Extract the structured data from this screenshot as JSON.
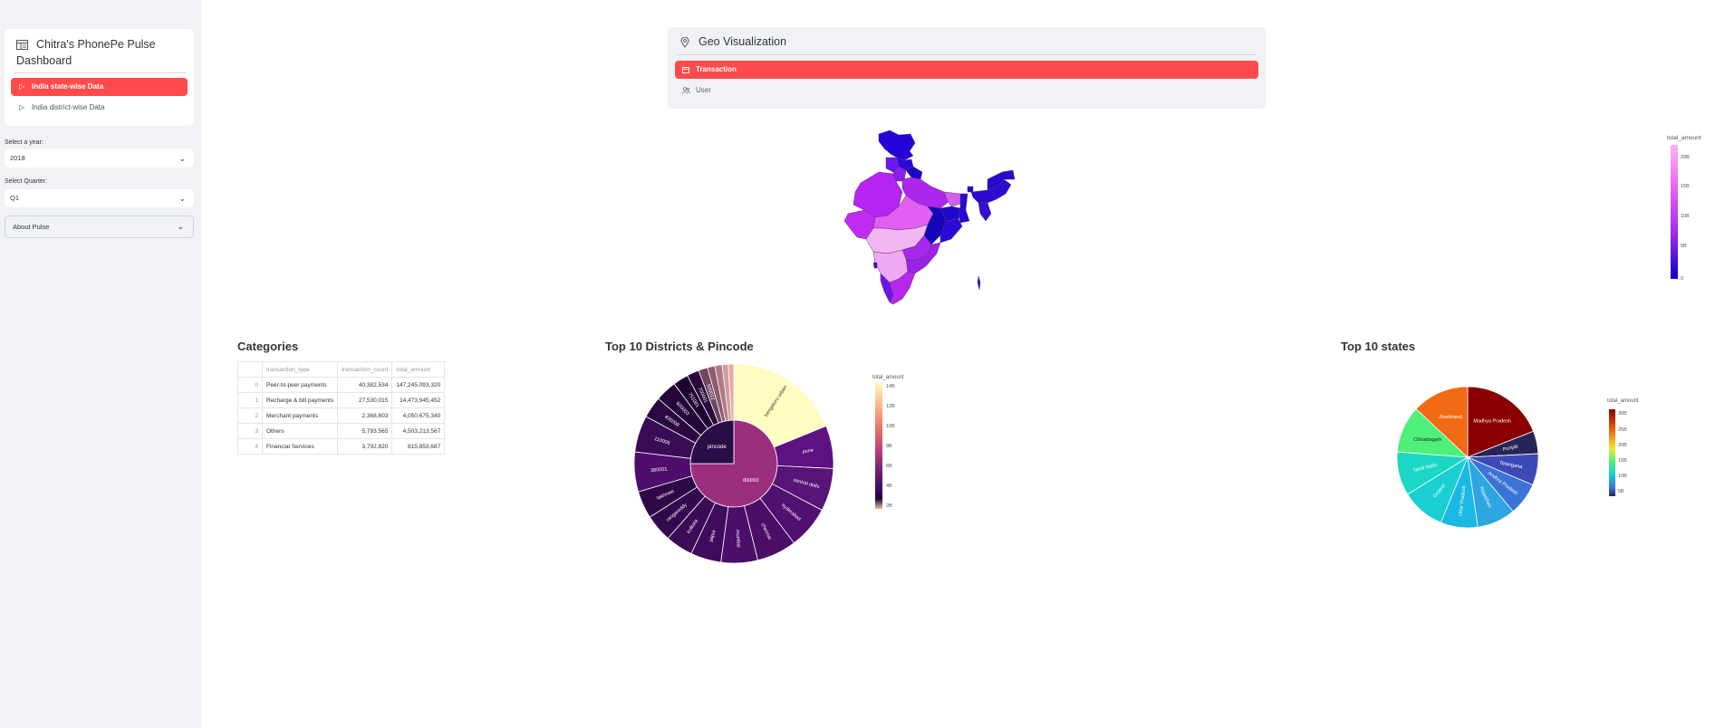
{
  "sidebar": {
    "menu_title_line1": "Chitra's PhonePe Pulse",
    "menu_title_line2": "Dashboard",
    "menu_items": [
      {
        "label": "India state-wise Data",
        "active": true
      },
      {
        "label": "India district-wise Data",
        "active": false
      }
    ],
    "year_label": "Select a year:",
    "year_value": "2018",
    "quarter_label": "Select Quarter:",
    "quarter_value": "Q1",
    "about_label": "About Pulse"
  },
  "geo": {
    "title": "Geo Visualization",
    "tabs": [
      {
        "label": "Transaction",
        "active": true
      },
      {
        "label": "User",
        "active": false
      }
    ],
    "colorbar_title": "total_amount",
    "colorbar_ticks": [
      "20B",
      "15B",
      "10B",
      "5B",
      "0"
    ]
  },
  "categories": {
    "title": "Categories",
    "columns": [
      "",
      "transaction_type",
      "transaction_count",
      "total_amount"
    ],
    "rows": [
      {
        "index": "0",
        "type": "Peer-to-peer payments",
        "count": "40,382,534",
        "amount": "147,245,093,320"
      },
      {
        "index": "1",
        "type": "Recharge & bill payments",
        "count": "27,530,015",
        "amount": "14,473,945,452"
      },
      {
        "index": "2",
        "type": "Merchant payments",
        "count": "2,368,603",
        "amount": "4,050,675,340"
      },
      {
        "index": "3",
        "type": "Others",
        "count": "5,793,565",
        "amount": "4,503,213,567"
      },
      {
        "index": "4",
        "type": "Financial Services",
        "count": "3,792,820",
        "amount": "815,853,687"
      }
    ]
  },
  "sunburst": {
    "title": "Top 10 Districts & Pincode",
    "inner": [
      {
        "label": "district",
        "start": 0,
        "end": 0.75,
        "color": "#9c2e7e"
      },
      {
        "label": "pincode",
        "start": 0.75,
        "end": 1.0,
        "color": "#2a0d47"
      }
    ],
    "outer": [
      {
        "label": "bengaluru urban",
        "value": 0.19,
        "color": "#fdfcc1"
      },
      {
        "label": "pune",
        "value": 0.07,
        "color": "#5d1280"
      },
      {
        "label": "central delhi",
        "value": 0.07,
        "color": "#581477"
      },
      {
        "label": "hyderabad",
        "value": 0.07,
        "color": "#4f1070"
      },
      {
        "label": "chennai",
        "value": 0.065,
        "color": "#4a0e67"
      },
      {
        "label": "mumbai",
        "value": 0.06,
        "color": "#4b0e6a"
      },
      {
        "label": "jaipur",
        "value": 0.05,
        "color": "#3f0c5b"
      },
      {
        "label": "kolkata",
        "value": 0.045,
        "color": "#3c0b58"
      },
      {
        "label": "rangareddy",
        "value": 0.045,
        "color": "#33094d"
      },
      {
        "label": "lakhnaw",
        "value": 0.045,
        "color": "#2e0846"
      },
      {
        "label": "380001",
        "value": 0.065,
        "color": "#4d0d6a"
      },
      {
        "label": "110006",
        "value": 0.06,
        "color": "#3a0b56"
      },
      {
        "label": "400008",
        "value": 0.035,
        "color": "#2b0840"
      },
      {
        "label": "600003",
        "value": 0.035,
        "color": "#240737"
      },
      {
        "label": "751001",
        "value": 0.025,
        "color": "#1e0530"
      },
      {
        "label": "700001",
        "value": 0.02,
        "color": "#2a0a3c"
      },
      {
        "label": "500012",
        "value": 0.015,
        "color": "#6f4560"
      },
      {
        "label": "",
        "value": 0.012,
        "color": "#8d5a70"
      },
      {
        "label": "",
        "value": 0.012,
        "color": "#b07a85"
      },
      {
        "label": "",
        "value": 0.01,
        "color": "#d59a9a"
      },
      {
        "label": "",
        "value": 0.009,
        "color": "#e9a8a8"
      }
    ],
    "colorbar_title": "total_amount",
    "colorbar_ticks": [
      "14B",
      "12B",
      "10B",
      "8B",
      "6B",
      "4B",
      "2B"
    ]
  },
  "pie": {
    "title": "Top 10 states",
    "slices": [
      {
        "label": "Madhya Pradesh",
        "value": 0.19,
        "color": "#8a0000"
      },
      {
        "label": "Punjab",
        "value": 0.052,
        "color": "#262656"
      },
      {
        "label": "Telangana",
        "value": 0.072,
        "color": "#3c49b6"
      },
      {
        "label": "Andhra Pradesh",
        "value": 0.075,
        "color": "#3b73d6"
      },
      {
        "label": "Rajasthan",
        "value": 0.088,
        "color": "#2ca5e0"
      },
      {
        "label": "Uttar Pradesh",
        "value": 0.085,
        "color": "#1ab9e3"
      },
      {
        "label": "Gujarat",
        "value": 0.1,
        "color": "#19cfd2"
      },
      {
        "label": "Tamil Nadu",
        "value": 0.1,
        "color": "#1ad8c4"
      },
      {
        "label": "Chhattisgarh",
        "value": 0.108,
        "color": "#4ef07a"
      },
      {
        "label": "Jharkhand",
        "value": 0.13,
        "color": "#f26a14"
      }
    ],
    "colorbar_title": "total_amount",
    "colorbar_ticks": [
      "30B",
      "25B",
      "20B",
      "15B",
      "10B",
      "5B"
    ]
  }
}
